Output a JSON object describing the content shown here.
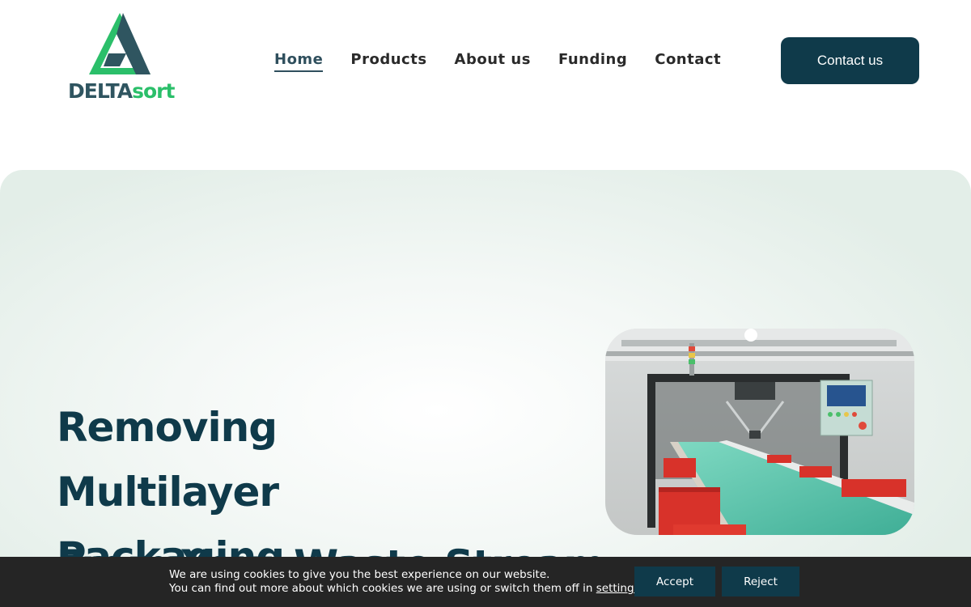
{
  "logo": {
    "part1": "DELTA",
    "part2": "sort"
  },
  "nav": {
    "items": [
      {
        "label": "Home",
        "active": true
      },
      {
        "label": "Products"
      },
      {
        "label": "About us"
      },
      {
        "label": "Funding"
      },
      {
        "label": "Contact"
      }
    ],
    "cta_label": "Contact us"
  },
  "hero": {
    "title": "Removing Multilayer Packaging",
    "subtitle": "From Your Waste Stream",
    "image_icon": "sorting-conveyor-photo"
  },
  "cookie": {
    "line1": "We are using cookies to give you the best experience on our website.",
    "line2_before": "You can find out more about which cookies we are using or switch them off in ",
    "link": "settings",
    "line2_after": ".",
    "accept": "Accept",
    "reject": "Reject"
  },
  "colors": {
    "primary": "#0f3a4a",
    "accent": "#2bbf6a",
    "cookie_bg": "#252525"
  }
}
